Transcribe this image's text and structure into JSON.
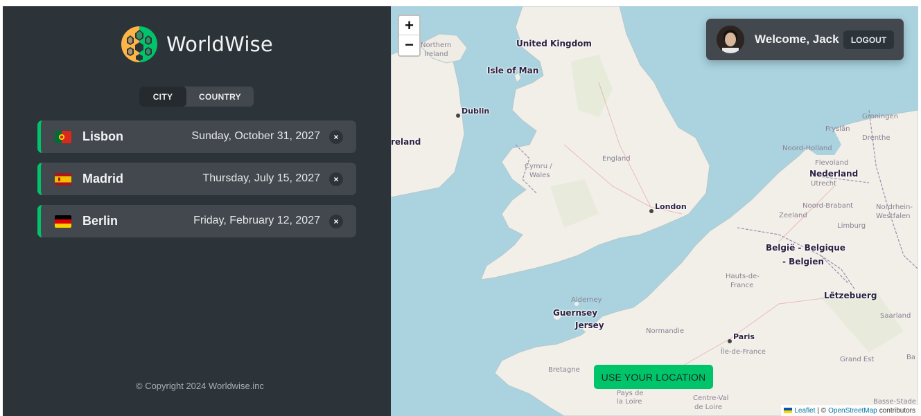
{
  "app": {
    "name": "WorldWise"
  },
  "tabs": [
    {
      "label": "CITY",
      "active": true
    },
    {
      "label": "COUNTRY",
      "active": false
    }
  ],
  "cities": [
    {
      "name": "Lisbon",
      "date": "Sunday, October 31, 2027",
      "flag": "Portugal"
    },
    {
      "name": "Madrid",
      "date": "Thursday, July 15, 2027",
      "flag": "Spain"
    },
    {
      "name": "Berlin",
      "date": "Friday, February 12, 2027",
      "flag": "Germany"
    }
  ],
  "delete_label": "×",
  "copyright": "© Copyright 2024 Worldwise.inc",
  "user": {
    "welcome": "Welcome, Jack",
    "logout_label": "LOGOUT"
  },
  "map": {
    "zoom_in": "+",
    "zoom_out": "−",
    "use_location_label": "USE YOUR LOCATION",
    "attribution": {
      "leaflet": "Leaflet",
      "separator": "| ©",
      "osm": "OpenStreetMap",
      "contributors": "contributors"
    },
    "labels": {
      "united_kingdom": "United Kingdom",
      "isle_of_man": "Isle of Man",
      "northern_ireland_1": "Northern",
      "northern_ireland_2": "Ireland",
      "dublin": "Dublin",
      "ireland": "reland",
      "cymru_1": "Cymru /",
      "cymru_2": "Wales",
      "england": "England",
      "london": "London",
      "nederland": "Nederland",
      "noord_holland": "Noord-Holland",
      "flevoland": "Flevoland",
      "utrecht": "Utrecht",
      "noord_brabant": "Noord-Brabant",
      "zeeland": "Zeeland",
      "limburg": "Limburg",
      "friesland": "Fryslân",
      "groningen": "Groningen",
      "drenthe": "Drenthe",
      "nordrhein_1": "Nordrhein-",
      "nordrhein_2": "Westfalen",
      "belgie_1": "België - Belgique",
      "belgie_2": "- Belgien",
      "hauts_1": "Hauts-de-",
      "hauts_2": "France",
      "letzebuerg": "Lëtzebuerg",
      "saarland": "Saarland",
      "alderney": "Alderney",
      "guernsey": "Guernsey",
      "jersey": "Jersey",
      "normandie": "Normandie",
      "paris": "Paris",
      "ile_de_france": "Île-de-France",
      "grand_est": "Grand Est",
      "bretagne": "Bretagne",
      "pays_1": "Pays de",
      "pays_2": "la Loire",
      "centre_1": "Centre-Val",
      "centre_2": "de Loire",
      "basse": "Basse-Stade",
      "ba": "Ba"
    }
  },
  "colors": {
    "sidebar_bg": "#2d3439",
    "card_bg": "#42484d",
    "accent_green": "#00c46a",
    "sea": "#aad3df",
    "land": "#f2efe9"
  }
}
